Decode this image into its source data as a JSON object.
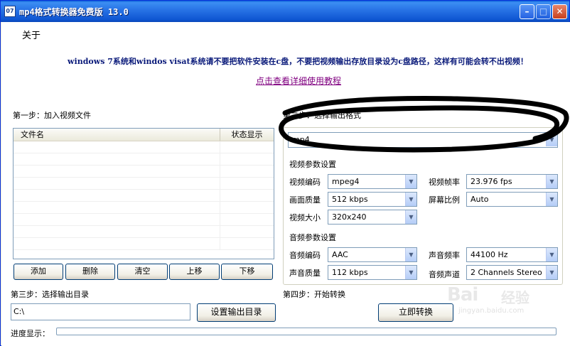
{
  "window": {
    "title": "mp4格式转换器免费版 13.0",
    "icon_label": "07"
  },
  "menu": {
    "about": "关于"
  },
  "notice": {
    "warning": "windows 7系统和windos visat系统请不要把软件安装在c盘，不要把视频输出存放目录设为c盘路径，这样有可能会转不出视频！",
    "tutorial_link": "点击查看详细使用教程"
  },
  "step1": {
    "label": "第一步：加入视频文件",
    "columns": [
      "文件名",
      "状态显示"
    ],
    "rows": [],
    "buttons": {
      "add": "添加",
      "delete": "删除",
      "clear": "清空",
      "up": "上移",
      "down": "下移"
    }
  },
  "step2": {
    "label": "第二步：选择输出格式",
    "format": "mp4",
    "video_settings": {
      "heading": "视频参数设置",
      "codec_label": "视频编码",
      "codec": "mpeg4",
      "framerate_label": "视频帧率",
      "framerate": "23.976 fps",
      "quality_label": "画面质量",
      "quality": "512 kbps",
      "aspect_label": "屏幕比例",
      "aspect": "Auto",
      "size_label": "视频大小",
      "size": "320x240"
    },
    "audio_settings": {
      "heading": "音频参数设置",
      "codec_label": "音频编码",
      "codec": "AAC",
      "samplerate_label": "声音频率",
      "samplerate": "44100 Hz",
      "quality_label": "声音质量",
      "quality": "112 kbps",
      "channels_label": "音频声道",
      "channels": "2 Channels Stereo"
    }
  },
  "step3": {
    "label": "第三步：选择输出目录",
    "path": "C:\\",
    "set_button": "设置输出目录"
  },
  "step4": {
    "label": "第四步：开始转换",
    "convert_button": "立即转换"
  },
  "progress": {
    "label": "进度显示：",
    "value": 0
  },
  "watermark": {
    "logo": "Bai",
    "text": "经验",
    "url": "jingyan.baidu.com"
  },
  "colors": {
    "titlebar": "#2a75e7",
    "annotation": "#000000",
    "progress": "#2c9e34"
  }
}
